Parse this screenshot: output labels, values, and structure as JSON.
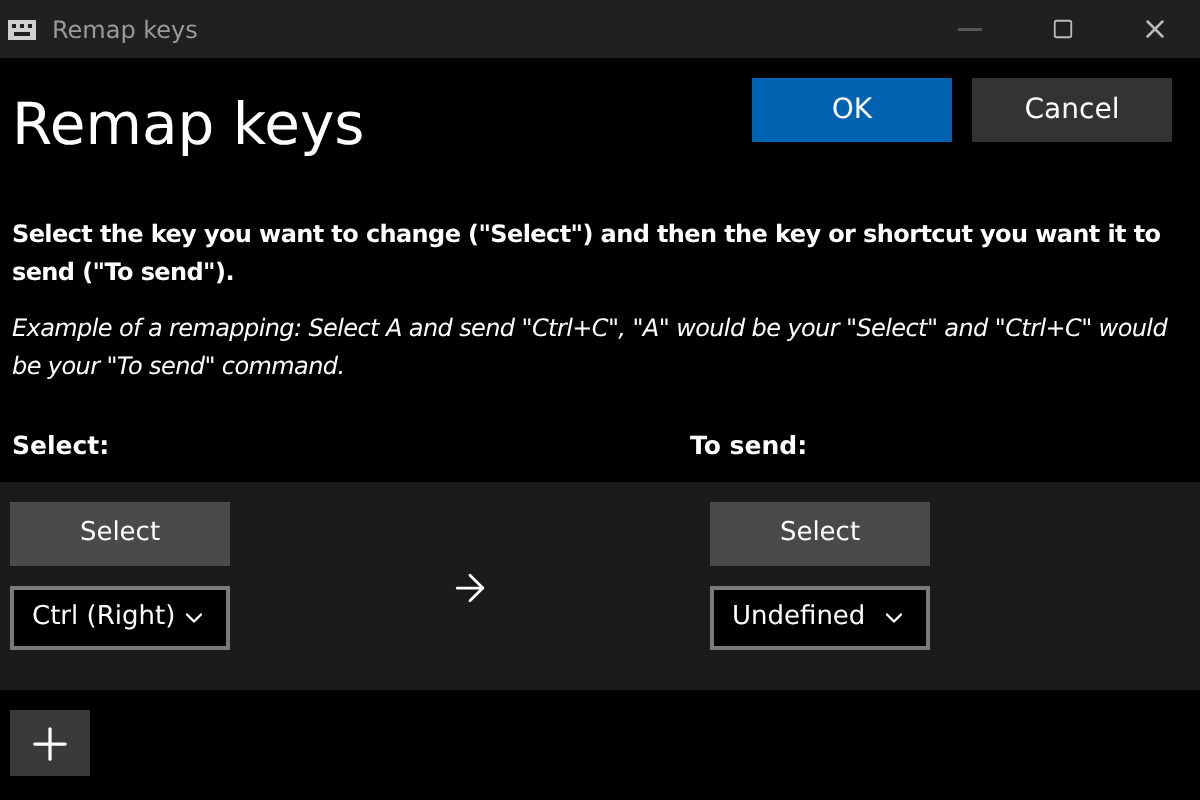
{
  "window": {
    "title": "Remap keys"
  },
  "heading": "Remap keys",
  "buttons": {
    "ok": "OK",
    "cancel": "Cancel"
  },
  "description": "Select the key you want to change (\"Select\") and then the key or shortcut you want it to send (\"To send\").",
  "example": "Example of a remapping: Select A and send \"Ctrl+C\", \"A\" would be your \"Select\" and \"Ctrl+C\" would be your \"To send\" command.",
  "columns": {
    "select": "Select:",
    "to_send": "To send:"
  },
  "mappings": [
    {
      "select_button": "Select",
      "original": "Ctrl (Right)",
      "to_send_button": "Select",
      "target": "Undefined"
    }
  ]
}
